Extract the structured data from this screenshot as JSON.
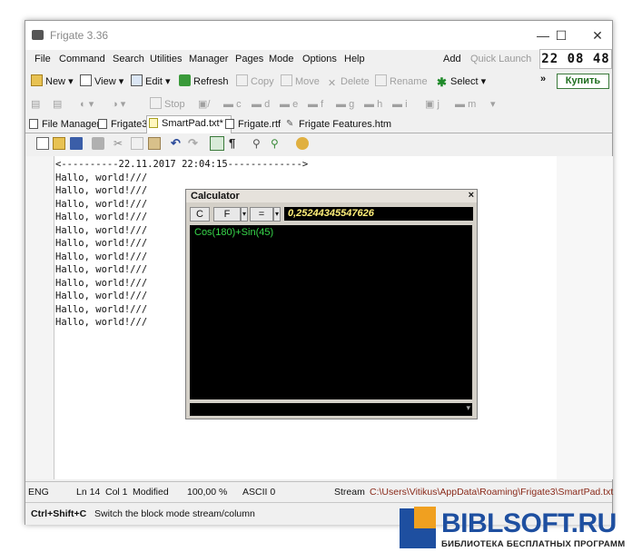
{
  "window": {
    "title": "Frigate 3.36",
    "minimize": "—",
    "maximize": "☐",
    "close": "✕"
  },
  "menu": [
    "File",
    "Command",
    "Search",
    "Utilities",
    "Manager",
    "Pages",
    "Mode",
    "Options",
    "Help"
  ],
  "quick": {
    "add": "Add",
    "quick_launch": "Quick Launch"
  },
  "clock": {
    "h": "22",
    "m": "08",
    "s": "48"
  },
  "toolbar": {
    "new": "New",
    "view": "View",
    "edit": "Edit",
    "refresh": "Refresh",
    "copy": "Copy",
    "move": "Move",
    "delete": "Delete",
    "rename": "Rename",
    "select": "Select",
    "more": "»",
    "buy": "Купить"
  },
  "toolbar2": {
    "stop": "Stop",
    "drives": [
      "/",
      "c",
      "d",
      "e",
      "f",
      "g",
      "h",
      "i",
      "j",
      "m"
    ]
  },
  "tabs": [
    "File Manager",
    "Frigate3",
    "SmartPad.txt*",
    "Frigate.rtf",
    "Frigate Features.htm"
  ],
  "editor": {
    "header": "<----------22.11.2017 22:04:15------------->",
    "lines": [
      "Hallo, world!///",
      "Hallo, world!///",
      "Hallo, world!///",
      "Hallo, world!///",
      "Hallo, world!///",
      "Hallo, world!///",
      "Hallo, world!///",
      "Hallo, world!///",
      "Hallo, world!///",
      "Hallo, world!///",
      "Hallo, world!///",
      "Hallo, world!///"
    ]
  },
  "calculator": {
    "title": "Calculator",
    "close": "×",
    "btn_c": "C",
    "btn_f": "F",
    "btn_eq": "=",
    "result": "0,25244345547626",
    "expression": "Cos(180)+Sin(45)"
  },
  "status": {
    "lang": "ENG",
    "ln": "Ln 14",
    "col": "Col 1",
    "state": "Modified",
    "zoom": "100,00 %",
    "encoding": "ASCII 0",
    "mode": "Stream",
    "path": "C:\\Users\\Vitikus\\AppData\\Roaming\\Frigate3\\SmartPad.txt"
  },
  "hint": {
    "keys": "Ctrl+Shift+C",
    "text": "Switch the block mode stream/column"
  },
  "watermark": {
    "title": "BIBLSOFT.RU",
    "subtitle": "БИБЛИОТЕКА БЕСПЛАТНЫХ ПРОГРАММ"
  }
}
